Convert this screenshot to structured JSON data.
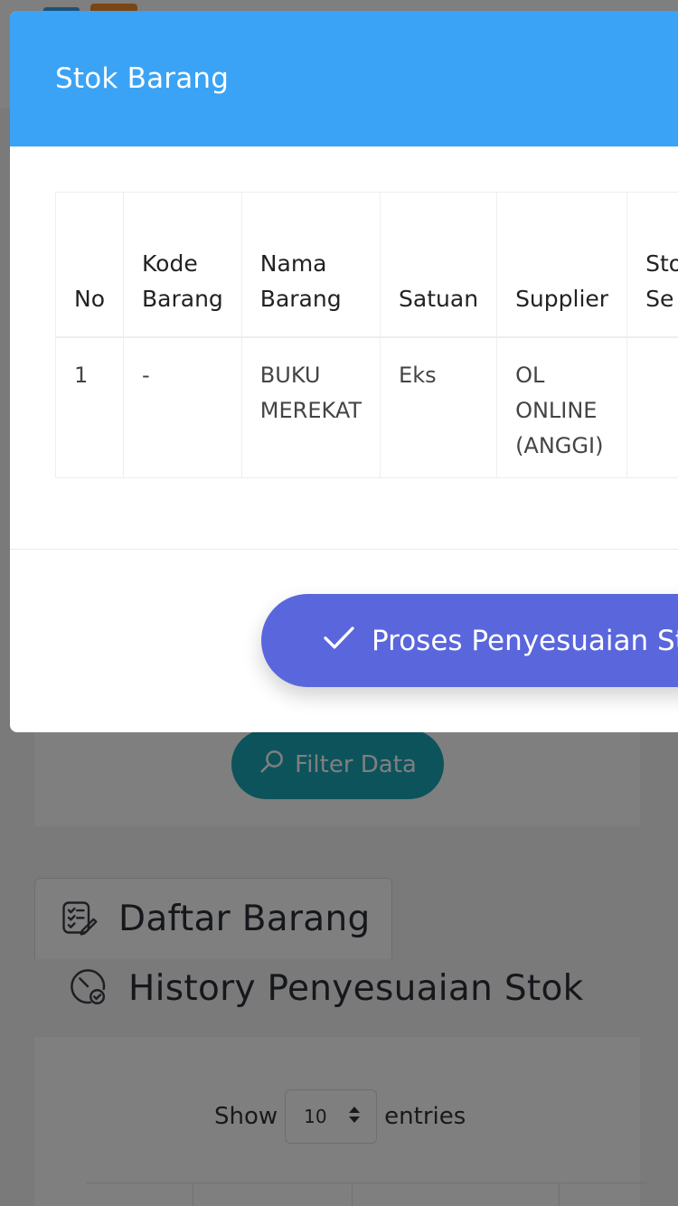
{
  "background": {
    "filter_button_label": "Filter Data",
    "tab_daftar_label": "Daftar Barang",
    "history_title": "History Penyesuaian Stok",
    "show_label": "Show",
    "entries_label": "entries",
    "page_length_value": "10"
  },
  "modal": {
    "title": "Stok Barang",
    "table": {
      "headers": [
        "No",
        "Kode\nBarang",
        "Nama\nBarang",
        "Satuan",
        "Supplier",
        "Stok\nSe"
      ],
      "rows": [
        [
          "1",
          "-",
          "BUKU\nMEREKAT",
          "Eks",
          "OL\nONLINE\n(ANGGI)",
          ""
        ]
      ]
    },
    "action_button_label": "Proses Penyesuaian St"
  },
  "colors": {
    "header_blue": "#3aa3f5",
    "action_purple": "#5a66dc",
    "filter_teal": "#1aa7b6"
  },
  "icons": {
    "filter": "search-icon",
    "daftar": "checklist-icon",
    "history": "clock-check-icon",
    "action": "check-icon"
  }
}
